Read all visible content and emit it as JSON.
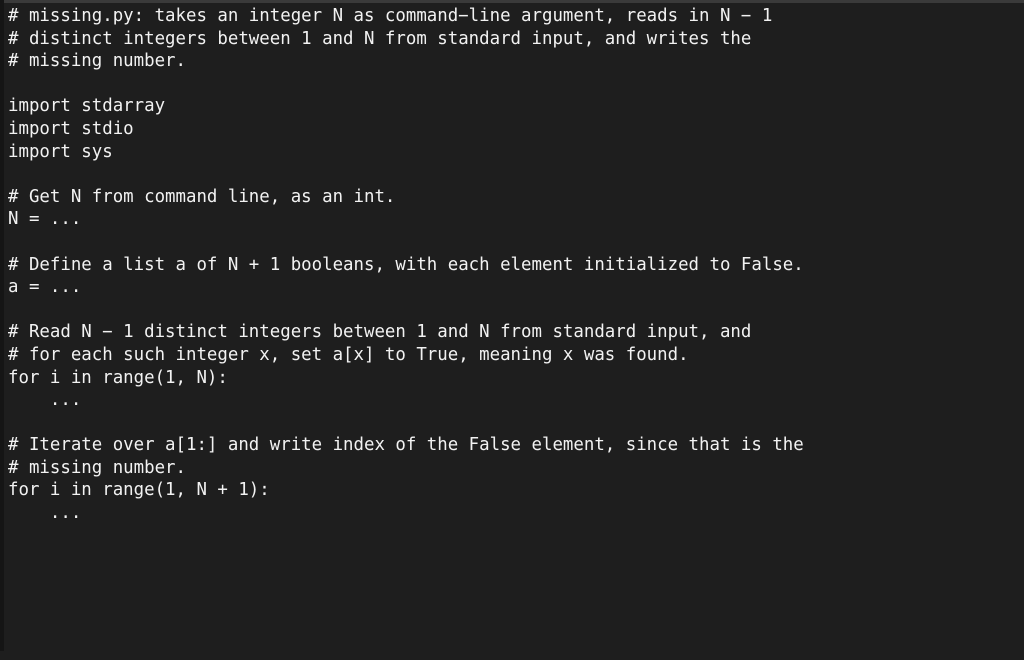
{
  "window": {
    "kind": "code-editor",
    "background_color": "#1e1e1e",
    "text_color": "#f2f2f2",
    "top_edge_color": "#3a3a3a",
    "left_edge_color": "#151515"
  },
  "code": {
    "language": "python",
    "lines": [
      "# missing.py: takes an integer N as command−line argument, reads in N − 1",
      "# distinct integers between 1 and N from standard input, and writes the",
      "# missing number.",
      "",
      "import stdarray",
      "import stdio",
      "import sys",
      "",
      "# Get N from command line, as an int.",
      "N = ...",
      "",
      "# Define a list a of N + 1 booleans, with each element initialized to False.",
      "a = ...",
      "",
      "# Read N − 1 distinct integers between 1 and N from standard input, and",
      "# for each such integer x, set a[x] to True, meaning x was found.",
      "for i in range(1, N):",
      "    ...",
      "",
      "# Iterate over a[1:] and write index of the False element, since that is the",
      "# missing number.",
      "for i in range(1, N + 1):",
      "    ...",
      "",
      "",
      "",
      "",
      "",
      ""
    ]
  }
}
